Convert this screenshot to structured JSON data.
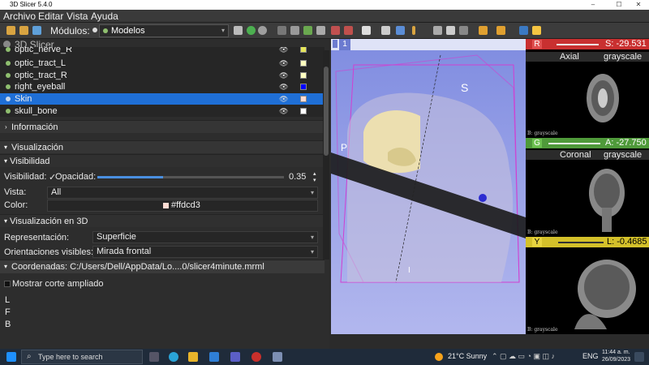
{
  "window": {
    "title": "3D Slicer 5.4.0"
  },
  "menu": [
    "Archivo",
    "Editar",
    "Vista",
    "Ayuda"
  ],
  "toolbar": {
    "modules_label": "Módulos:",
    "module_value": "Modelos"
  },
  "panel": {
    "header": "3D Slicer"
  },
  "models": [
    {
      "name": "optic_nerve_R",
      "color": "#e6e65a",
      "selected": false
    },
    {
      "name": "optic_tract_L",
      "color": "#ffffc0",
      "selected": false
    },
    {
      "name": "optic_tract_R",
      "color": "#ffffc0",
      "selected": false
    },
    {
      "name": "right_eyeball",
      "color": "#0000ff",
      "selected": false
    },
    {
      "name": "Skin",
      "color": "#ffdcd3",
      "selected": true
    },
    {
      "name": "skull_bone",
      "color": "#ffffff",
      "selected": false
    }
  ],
  "sections": {
    "info": "Información",
    "visualization": "Visualización",
    "visibility": "Visibilidad",
    "vis3d": "Visualización en 3D",
    "coords": "Coordenadas: C:/Users/Dell/AppData/Lo....0/slicer4minute.mrml"
  },
  "visibility": {
    "visibility_label": "Visibilidad:",
    "opacity_label": "Opacidad:",
    "opacity_value": "0.35",
    "opacity_level": 0.35,
    "vista_label": "Vista:",
    "vista_value": "All",
    "color_label": "Color:",
    "color_value": "#ffdcd3"
  },
  "vis3d": {
    "rep_label": "Representación:",
    "rep_value": "Superficie",
    "orient_label": "Orientaciones visibles:",
    "orient_value": "Mirada frontal"
  },
  "crosshair": {
    "label": "Mostrar corte ampliado"
  },
  "legend": [
    "L",
    "F",
    "B"
  ],
  "view3d": {
    "tab": "1",
    "S": "S",
    "P": "P",
    "I": "I"
  },
  "slices": [
    {
      "letter": "R",
      "value": "S: -29.531",
      "color": "#c93030",
      "orient": "Axial",
      "volume": "grayscale",
      "caption": "B: grayscale"
    },
    {
      "letter": "G",
      "value": "A: -27.750",
      "color": "#4f9a3a",
      "orient": "Coronal",
      "volume": "grayscale",
      "caption": "B: grayscale"
    },
    {
      "letter": "Y",
      "value": "L: -0.4685",
      "color": "#d4c12a",
      "orient": "",
      "volume": "",
      "caption": "B: grayscale"
    }
  ],
  "taskbar": {
    "search": "Type here to search",
    "weather": "21°C  Sunny",
    "lang": "ENG",
    "time": "11:44 a. m.",
    "date": "26/09/2023"
  }
}
